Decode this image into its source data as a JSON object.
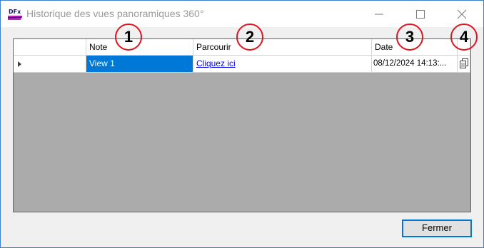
{
  "window": {
    "title": "Historique des vues panoramiques 360°",
    "app_icon_text": "DFx",
    "border_color": "#3a7fd0"
  },
  "grid": {
    "columns": [
      "Note",
      "Parcourir",
      "Date"
    ],
    "rows": [
      {
        "note": "View 1",
        "parcourir": "Cliquez ici",
        "date": "08/12/2024 14:13:..."
      }
    ],
    "selection_color": "#0078d7"
  },
  "markers": [
    "1",
    "2",
    "3",
    "4"
  ],
  "footer": {
    "close_label": "Fermer"
  }
}
